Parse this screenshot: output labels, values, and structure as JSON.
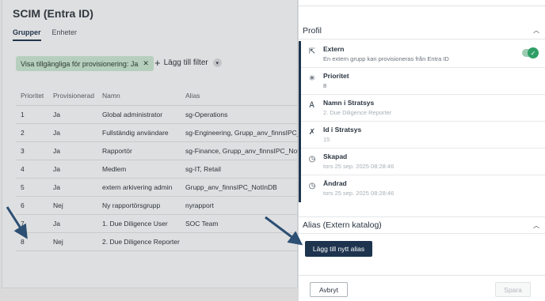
{
  "page": {
    "title": "SCIM (Entra ID)"
  },
  "tabs": [
    {
      "label": "Grupper"
    },
    {
      "label": "Enheter"
    }
  ],
  "filter": {
    "chip_label": "Visa tillgängliga för provisionering: Ja",
    "add_filter_label": "Lägg till filter"
  },
  "table": {
    "headers": [
      "Prioritet",
      "Provisionerad",
      "Namn",
      "Alias"
    ],
    "rows": [
      [
        "1",
        "Ja",
        "Global administrator",
        "sg-Operations"
      ],
      [
        "2",
        "Ja",
        "Fullständig användare",
        "sg-Engineering, Grupp_anv_finnsIPC_NotInDB"
      ],
      [
        "3",
        "Ja",
        "Rapportör",
        "sg-Finance, Grupp_anv_finnsIPC_NotInDB"
      ],
      [
        "4",
        "Ja",
        "Medlem",
        "sg-IT, Retail"
      ],
      [
        "5",
        "Ja",
        "extern arkivering admin",
        "Grupp_anv_finnsIPC_NotInDB"
      ],
      [
        "6",
        "Nej",
        "Ny rapportörsgrupp",
        "nyrapport"
      ],
      [
        "7",
        "Ja",
        "1. Due Diligence User",
        "SOC Team"
      ],
      [
        "8",
        "Nej",
        "2. Due Diligence Reporter",
        ""
      ]
    ]
  },
  "panel": {
    "profile_header": "Profil",
    "fields": [
      {
        "label": "Extern",
        "value": "En extern grupp kan provisioneras från Entra ID",
        "icon": "external-icon"
      },
      {
        "label": "Prioritet",
        "value": "8",
        "icon": "priority-icon"
      },
      {
        "label": "Namn i Stratsys",
        "value": "2. Due Diligence Reporter",
        "icon": "name-icon"
      },
      {
        "label": "Id i Stratsys",
        "value": "15",
        "icon": "id-icon"
      },
      {
        "label": "Skapad",
        "value": "tors 25 sep. 2025 08:28:46",
        "icon": "clock-icon"
      },
      {
        "label": "Ändrad",
        "value": "tors 25 sep. 2025 08:28:46",
        "icon": "clock-icon"
      }
    ],
    "alias_header": "Alias (Extern katalog)",
    "add_alias_label": "Lägg till nytt alias",
    "cancel_label": "Avbryt",
    "save_label": "Spara"
  },
  "colors": {
    "accent": "#1e344e",
    "chip": "#c4e0cc",
    "toggle": "#2f9e66",
    "annotation_arrow": "#2c4f73"
  }
}
